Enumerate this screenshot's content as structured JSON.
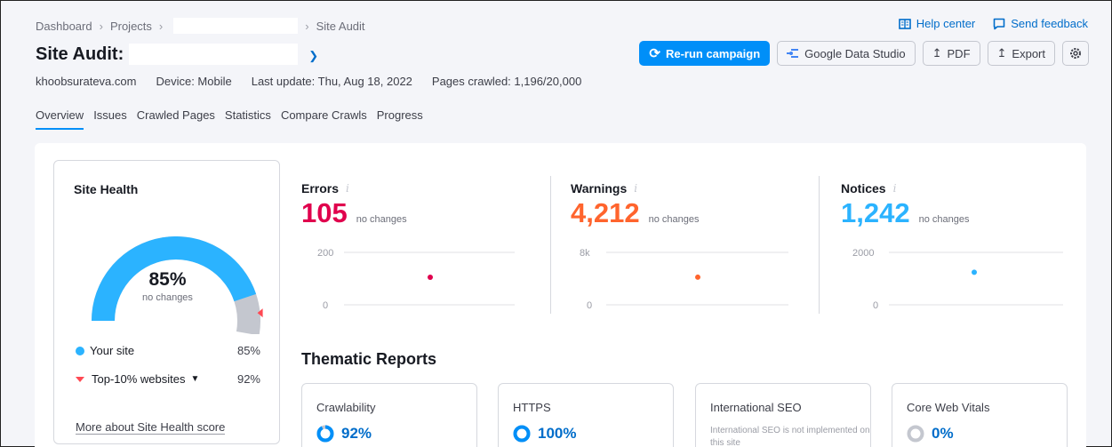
{
  "breadcrumb": {
    "items": [
      "Dashboard",
      "Projects"
    ],
    "current": "Site Audit"
  },
  "top_links": {
    "help": "Help center",
    "feedback": "Send feedback"
  },
  "title": "Site Audit:",
  "actions": {
    "rerun": "Re-run campaign",
    "gds": "Google Data Studio",
    "pdf": "PDF",
    "export": "Export"
  },
  "meta": {
    "domain": "khoobsurateva.com",
    "device": "Device: Mobile",
    "last_update": "Last update: Thu, Aug 18, 2022",
    "pages": "Pages crawled: 1,196/20,000"
  },
  "tabs": [
    "Overview",
    "Issues",
    "Crawled Pages",
    "Statistics",
    "Compare Crawls",
    "Progress"
  ],
  "site_health": {
    "title": "Site Health",
    "percent": "85%",
    "sub": "no changes",
    "your_site_label": "Your site",
    "your_site_value": "85%",
    "top10_label": "Top-10% websites",
    "top10_value": "92%",
    "more_link": "More about Site Health score",
    "score_fraction": 0.85,
    "top10_fraction": 0.92
  },
  "metrics": [
    {
      "label": "Errors",
      "value": "105",
      "change": "no changes",
      "color": "#e0004d",
      "y_top": "200",
      "y_bottom": "0",
      "ymax": 200,
      "point": 105
    },
    {
      "label": "Warnings",
      "value": "4,212",
      "change": "no changes",
      "color": "#ff642d",
      "y_top": "8k",
      "y_bottom": "0",
      "ymax": 8000,
      "point": 4212
    },
    {
      "label": "Notices",
      "value": "1,242",
      "change": "no changes",
      "color": "#2bb3ff",
      "y_top": "2000",
      "y_bottom": "0",
      "ymax": 2000,
      "point": 1242
    }
  ],
  "info_glyph": "i",
  "thematic": {
    "title": "Thematic Reports",
    "cards": [
      {
        "title": "Crawlability",
        "value": "92%",
        "fraction": 0.92
      },
      {
        "title": "HTTPS",
        "value": "100%",
        "fraction": 1.0
      },
      {
        "title": "International SEO",
        "note": "International SEO is not implemented on this site"
      },
      {
        "title": "Core Web Vitals",
        "value": "0%",
        "fraction": 0
      }
    ]
  },
  "colors": {
    "accent": "#008ff8",
    "link": "#006dca",
    "gauge": "#2bb3ff",
    "gauge_rest": "#c4c7cf",
    "marker": "#ff4953"
  }
}
